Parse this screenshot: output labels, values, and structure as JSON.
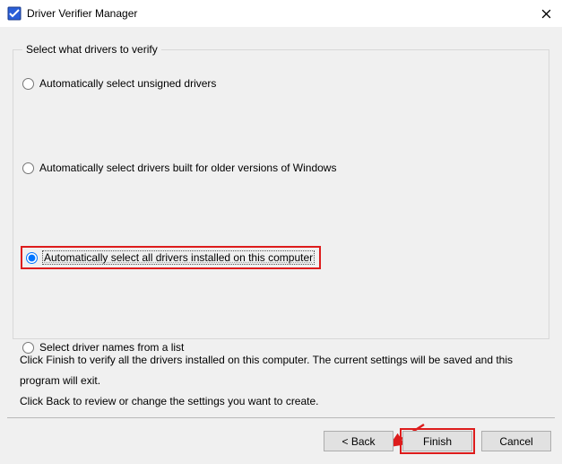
{
  "window": {
    "title": "Driver Verifier Manager"
  },
  "group": {
    "legend": "Select what drivers to verify"
  },
  "options": {
    "opt1": {
      "label": "Automatically select unsigned drivers",
      "checked": false
    },
    "opt2": {
      "label": "Automatically select drivers built for older versions of Windows",
      "checked": false
    },
    "opt3": {
      "label": "Automatically select all drivers installed on this computer",
      "checked": true
    },
    "opt4": {
      "label": "Select driver names from a list",
      "checked": false
    }
  },
  "info": {
    "line1": "Click Finish to verify all the drivers installed on this computer. The current settings will be saved and this program will exit.",
    "line2": "Click Back to review or change the settings you want to create."
  },
  "buttons": {
    "back": "< Back",
    "finish": "Finish",
    "cancel": "Cancel"
  }
}
